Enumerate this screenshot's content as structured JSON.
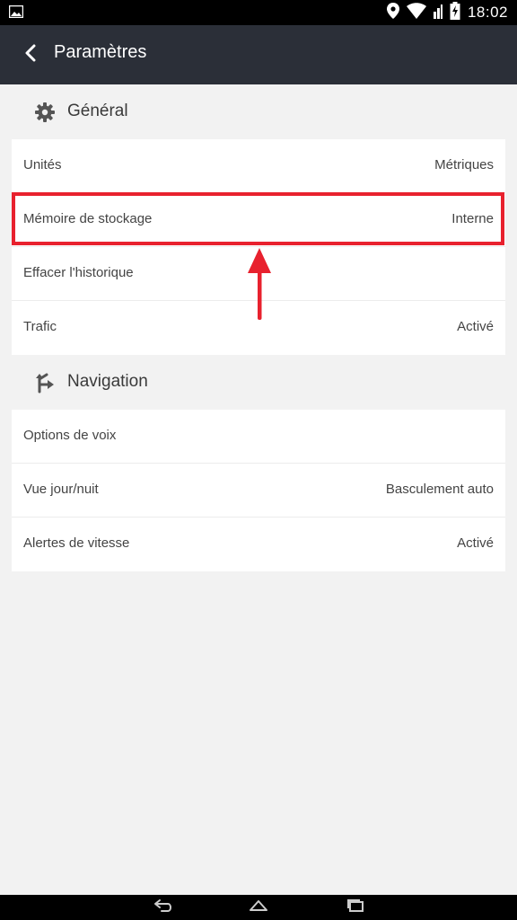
{
  "status_bar": {
    "time": "18:02",
    "icons": [
      "image-icon",
      "location-icon",
      "wifi-icon",
      "battery-icon"
    ]
  },
  "app_bar": {
    "title": "Paramètres",
    "back_icon": "back-arrow-icon"
  },
  "sections": {
    "general": {
      "title": "Général",
      "icon": "gear-icon",
      "items": [
        {
          "label": "Unités",
          "value": "Métriques"
        },
        {
          "label": "Mémoire de stockage",
          "value": "Interne"
        },
        {
          "label": "Effacer l'historique",
          "value": ""
        },
        {
          "label": "Trafic",
          "value": "Activé"
        }
      ]
    },
    "navigation": {
      "title": "Navigation",
      "icon": "route-icon",
      "items": [
        {
          "label": "Options de voix",
          "value": ""
        },
        {
          "label": "Vue jour/nuit",
          "value": "Basculement auto"
        },
        {
          "label": "Alertes de vitesse",
          "value": "Activé"
        }
      ]
    }
  },
  "annotation": {
    "highlight_color": "#e8212e"
  },
  "colors": {
    "app_bar": "#2b2f38",
    "background": "#f2f2f2"
  }
}
